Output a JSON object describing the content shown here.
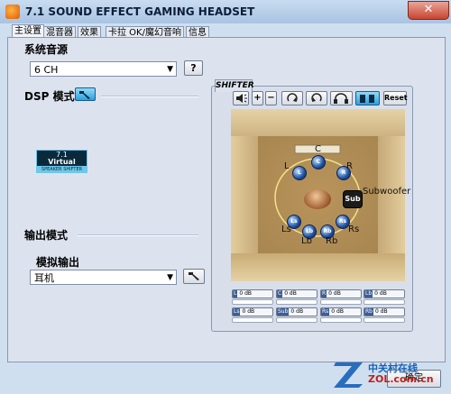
{
  "window": {
    "title": "7.1 SOUND EFFECT GAMING HEADSET",
    "close_glyph": "✕"
  },
  "tabs": [
    {
      "label": "主设置",
      "active": true
    },
    {
      "label": "混音器",
      "active": false
    },
    {
      "label": "效果",
      "active": false
    },
    {
      "label": "卡拉 OK/魔幻音响",
      "active": false
    },
    {
      "label": "信息",
      "active": false
    }
  ],
  "source": {
    "heading": "系统音源",
    "selected": "6 CH",
    "help_label": "?"
  },
  "dsp": {
    "heading": "DSP 模式",
    "badge_line1": "7.1",
    "badge_line2": "Virtual",
    "badge_line3": "SPEAKER SHIFTER"
  },
  "output": {
    "heading": "输出模式",
    "sub_heading": "模拟输出",
    "selected": "耳机"
  },
  "shifter": {
    "tab_label": "SHIFTER",
    "reset_label": "Reset",
    "speakers": [
      {
        "id": "C",
        "label": "C"
      },
      {
        "id": "L",
        "label": "L"
      },
      {
        "id": "R",
        "label": "R"
      },
      {
        "id": "Sub",
        "label": "Subwoofer"
      },
      {
        "id": "Ls",
        "label": "Ls"
      },
      {
        "id": "Rs",
        "label": "Rs"
      },
      {
        "id": "Lb",
        "label": "Lb"
      },
      {
        "id": "Rb",
        "label": "Rb"
      }
    ]
  },
  "levels": [
    {
      "tag": "L",
      "value": "0 dB"
    },
    {
      "tag": "C",
      "value": "0 dB"
    },
    {
      "tag": "R",
      "value": "0 dB"
    },
    {
      "tag": "Lb",
      "value": "0 dB"
    },
    {
      "tag": "Ls",
      "value": "0 dB"
    },
    {
      "tag": "Sub",
      "value": "0 dB"
    },
    {
      "tag": "Rs",
      "value": "0 dB"
    },
    {
      "tag": "Rb",
      "value": "0 dB"
    }
  ],
  "footer": {
    "ok_label": "确定",
    "watermark_main": "中关村在线",
    "watermark_url": "ZOL.com.cn"
  },
  "colors": {
    "accent": "#2ca0de",
    "speaker": "#1e4fa0",
    "room": "#c3a673"
  }
}
